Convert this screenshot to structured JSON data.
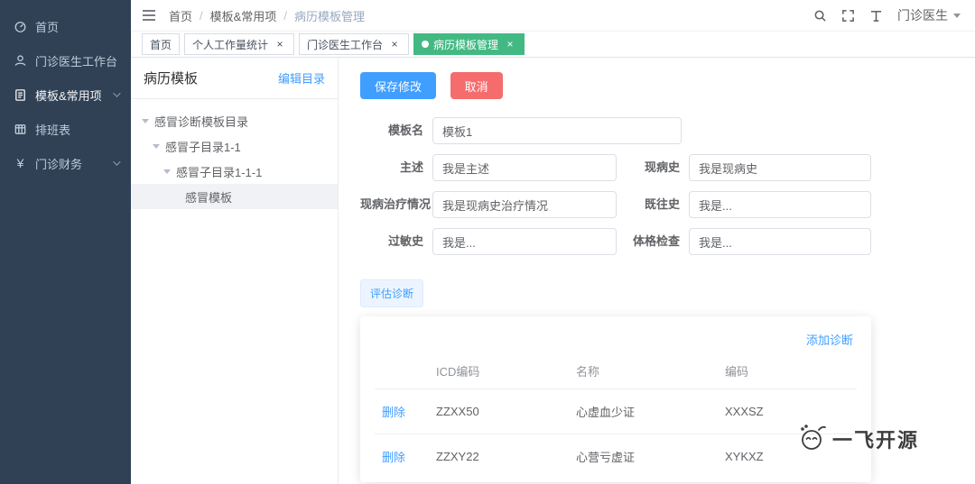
{
  "sidebar": {
    "items": [
      {
        "label": "首页",
        "icon": "dashboard-icon",
        "arrow": false
      },
      {
        "label": "门诊医生工作台",
        "icon": "doctor-workbench-icon",
        "arrow": false
      },
      {
        "label": "模板&常用项",
        "icon": "template-icon",
        "arrow": true
      },
      {
        "label": "排班表",
        "icon": "schedule-icon",
        "arrow": false
      },
      {
        "label": "门诊财务",
        "icon": "finance-icon",
        "glyph": "¥",
        "arrow": true
      }
    ]
  },
  "navbar": {
    "breadcrumb": {
      "items": [
        "首页",
        "模板&常用项",
        "病历模板管理"
      ],
      "separator": "/"
    },
    "user": {
      "name": "门诊医生"
    }
  },
  "tags_view": {
    "close_glyph": "×",
    "tabs": [
      {
        "label": "首页",
        "closable": false,
        "active": false
      },
      {
        "label": "个人工作量统计",
        "closable": true,
        "active": false
      },
      {
        "label": "门诊医生工作台",
        "closable": true,
        "active": false
      },
      {
        "label": "病历模板管理",
        "closable": true,
        "active": true
      }
    ]
  },
  "tree_panel": {
    "title": "病历模板",
    "edit_button": "编辑目录",
    "nodes": [
      {
        "label": "感冒诊断模板目录",
        "level": 0,
        "expanded": true,
        "selected": false
      },
      {
        "label": "感冒子目录1-1",
        "level": 1,
        "expanded": true,
        "selected": false
      },
      {
        "label": "感冒子目录1-1-1",
        "level": 2,
        "expanded": true,
        "selected": false
      },
      {
        "label": "感冒模板",
        "level": 3,
        "expanded": false,
        "selected": true
      }
    ]
  },
  "editor": {
    "save_button": "保存修改",
    "cancel_button": "取消",
    "fields": [
      {
        "label": "模板名",
        "value": "模板1"
      },
      {
        "label": "主述",
        "value": "我是主述"
      },
      {
        "label": "现病史",
        "value": "我是现病史"
      },
      {
        "label": "现病治疗情况",
        "value": "我是现病史治疗情况"
      },
      {
        "label": "既往史",
        "value": "我是..."
      },
      {
        "label": "过敏史",
        "value": "我是..."
      },
      {
        "label": "体格检查",
        "value": "我是..."
      }
    ],
    "diagnosis": {
      "tab_label": "评估诊断",
      "add_button": "添加诊断",
      "delete_label": "删除",
      "columns": {
        "action": "",
        "icd": "ICD编码",
        "name": "名称",
        "code": "编码"
      },
      "rows": [
        {
          "icd": "ZZXX50",
          "name": "心虚血少证",
          "code": "XXXSZ"
        },
        {
          "icd": "ZZXY22",
          "name": "心营亏虚证",
          "code": "XYKXZ"
        }
      ]
    }
  },
  "watermark": {
    "text": "一飞开源"
  },
  "colors": {
    "sidebar_bg": "#304156",
    "primary": "#409eff",
    "danger": "#f56c6c",
    "active_tag": "#42b983",
    "link": "#409eff"
  }
}
